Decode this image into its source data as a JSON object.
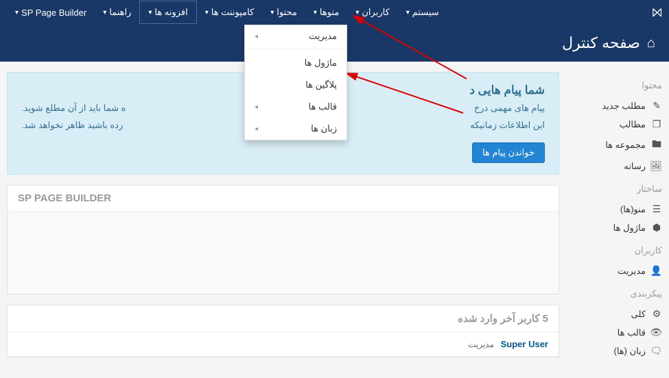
{
  "navbar": {
    "items": [
      {
        "label": "SP Page Builder"
      },
      {
        "label": "راهنما"
      },
      {
        "label": "افزونه ها",
        "active": true
      },
      {
        "label": "کامپوننت ها"
      },
      {
        "label": "محتوا"
      },
      {
        "label": "منوها"
      },
      {
        "label": "کاربران"
      },
      {
        "label": "سیستم"
      }
    ]
  },
  "dropdown": {
    "items": [
      {
        "label": "مدیریت",
        "hasArrow": true,
        "sep": true
      },
      {
        "label": "ماژول ها"
      },
      {
        "label": "پلاگین ها"
      },
      {
        "label": "قالب ها",
        "hasArrow": true
      },
      {
        "label": "زبان ها",
        "hasArrow": true
      }
    ]
  },
  "header": {
    "title": "صفحه کنترل"
  },
  "sidebar": {
    "sections": [
      {
        "heading": "محتوا",
        "items": [
          {
            "icon": "✎",
            "label": "مطلب جدید",
            "name": "new-article"
          },
          {
            "icon": "❐",
            "label": "مطالب",
            "name": "articles"
          },
          {
            "icon": "🖿",
            "label": "مجموعه ها",
            "name": "categories"
          },
          {
            "icon": "🖼",
            "label": "رسانه",
            "name": "media"
          }
        ]
      },
      {
        "heading": "ساختار",
        "items": [
          {
            "icon": "☰",
            "label": "منو(ها)",
            "name": "menus"
          },
          {
            "icon": "⬢",
            "label": "ماژول ها",
            "name": "modules"
          }
        ]
      },
      {
        "heading": "کاربران",
        "items": [
          {
            "icon": "👤",
            "label": "مدیریت",
            "name": "users-manage"
          }
        ]
      },
      {
        "heading": "پیکربندی",
        "items": [
          {
            "icon": "⚙",
            "label": "کلی",
            "name": "global"
          },
          {
            "icon": "👁",
            "label": "قالب ها",
            "name": "templates"
          },
          {
            "icon": "🗨",
            "label": "زبان (ها)",
            "name": "languages"
          }
        ]
      }
    ]
  },
  "messageBox": {
    "title": "شما پیام هایی د",
    "line1": "پیام های مهمی درخ",
    "line2suffix": "ه شما باید از آن مطلع شوید.",
    "line3prefix": "این اطلاعات زمانیکه ",
    "line3suffix": "رده باشید ظاهر نخواهد شد.",
    "button": "خواندن پیام ها"
  },
  "panel1": {
    "heading": "SP PAGE BUILDER"
  },
  "panel2": {
    "heading": "5 کاربر آخر وارد شده",
    "user": "Super User",
    "role": "مدیریت"
  }
}
